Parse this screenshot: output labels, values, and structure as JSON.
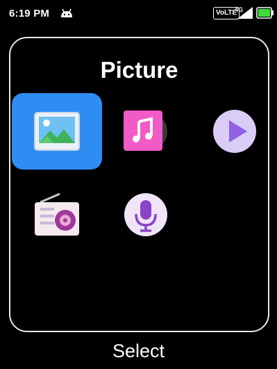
{
  "status_bar": {
    "time": "6:19 PM",
    "network_badge": "VoLTE",
    "network_type": "4G",
    "battery_color": "#3ddc3d",
    "icons": [
      "android-icon",
      "signal-icon",
      "battery-icon"
    ]
  },
  "panel": {
    "title": "Picture",
    "apps": [
      {
        "name": "gallery",
        "icon": "image-icon",
        "selected": true
      },
      {
        "name": "music",
        "icon": "music-note-icon",
        "selected": false
      },
      {
        "name": "video",
        "icon": "play-icon",
        "selected": false
      },
      {
        "name": "fm-radio",
        "icon": "radio-icon",
        "selected": false
      },
      {
        "name": "recorder",
        "icon": "microphone-icon",
        "selected": false
      }
    ]
  },
  "colors": {
    "selection": "#2f8cf3",
    "panel_border": "#e9e9e9"
  },
  "softkeys": {
    "center": "Select"
  }
}
